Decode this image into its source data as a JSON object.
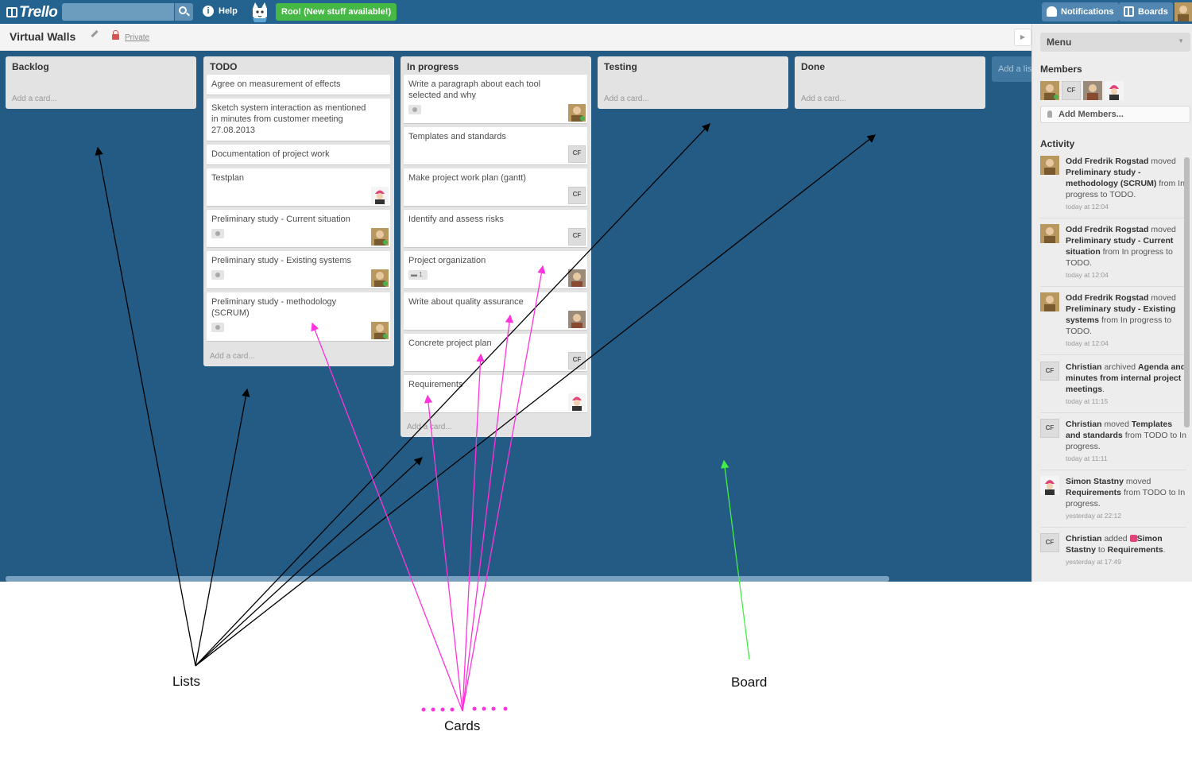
{
  "app": {
    "logo_text": "Trello",
    "help_label": "Help",
    "roo_label": "Roo! (New stuff available!)",
    "notifications_label": "Notifications",
    "boards_label": "Boards",
    "search": {
      "value": "",
      "placeholder": ""
    }
  },
  "board": {
    "title": "Virtual Walls",
    "visibility": "Private",
    "add_list_label": "Add a list...",
    "background_color": "#235b84",
    "lists": [
      {
        "title": "Backlog",
        "add_card": "Add a card...",
        "cards": []
      },
      {
        "title": "TODO",
        "add_card": "Add a card...",
        "cards": [
          {
            "title": "Agree on measurement of effects"
          },
          {
            "title": "Sketch system interaction as mentioned in minutes from customer meeting 27.08.2013"
          },
          {
            "title": "Documentation of project work"
          },
          {
            "title": "Testplan"
          },
          {
            "title": "Preliminary study - Current situation"
          },
          {
            "title": "Preliminary study - Existing systems"
          },
          {
            "title": "Preliminary study - methodology (SCRUM)"
          }
        ]
      },
      {
        "title": "In progress",
        "add_card": "Add a card...",
        "cards": [
          {
            "title": "Write a paragraph about each tool selected and why"
          },
          {
            "title": "Templates and standards",
            "member": "CF"
          },
          {
            "title": "Make project work plan (gantt)",
            "member": "CF"
          },
          {
            "title": "Identify and assess risks",
            "member": "CF"
          },
          {
            "title": "Project organization",
            "comments": "1"
          },
          {
            "title": "Write about quality assurance"
          },
          {
            "title": "Concrete project plan",
            "member": "CF"
          },
          {
            "title": "Requirements"
          }
        ]
      },
      {
        "title": "Testing",
        "add_card": "Add a card...",
        "cards": []
      },
      {
        "title": "Done",
        "add_card": "Add a card...",
        "cards": []
      }
    ]
  },
  "sidebar": {
    "menu_label": "Menu",
    "members_heading": "Members",
    "member_initials": "CF",
    "add_members_label": "Add Members...",
    "activity_heading": "Activity",
    "activities": [
      {
        "actor": "Odd Fredrik Rogstad",
        "parts": [
          "moved ",
          "Preliminary study - methodology (SCRUM)",
          " from In progress to TODO."
        ],
        "time": "today at 12:04"
      },
      {
        "actor": "Odd Fredrik Rogstad",
        "parts": [
          "moved ",
          "Preliminary study - Current situation",
          " from In progress to TODO."
        ],
        "time": "today at 12:04"
      },
      {
        "actor": "Odd Fredrik Rogstad",
        "parts": [
          "moved ",
          "Preliminary study - Existing systems",
          " from In progress to TODO."
        ],
        "time": "today at 12:04"
      },
      {
        "actor": "Christian",
        "parts": [
          "archived ",
          "Agenda and minutes from internal project meetings",
          "."
        ],
        "time": "today at 11:15"
      },
      {
        "actor": "Christian",
        "parts": [
          "moved ",
          "Templates and standards",
          " from TODO to In progress."
        ],
        "time": "today at 11:11"
      },
      {
        "actor": "Simon Stastny",
        "parts": [
          "moved ",
          "Requirements",
          " from TODO to In progress."
        ],
        "time": "yesterday at 22:12"
      },
      {
        "actor": "Christian",
        "parts": [
          "added ",
          "Simon Stastny",
          " to ",
          "Requirements",
          "."
        ],
        "time": "yesterday at 17:49"
      }
    ]
  },
  "annotations": {
    "lists_label": "Lists",
    "cards_label": "Cards",
    "board_label": "Board",
    "lists_color": "#000000",
    "cards_color": "#ff33dd",
    "board_color": "#44ee44"
  }
}
